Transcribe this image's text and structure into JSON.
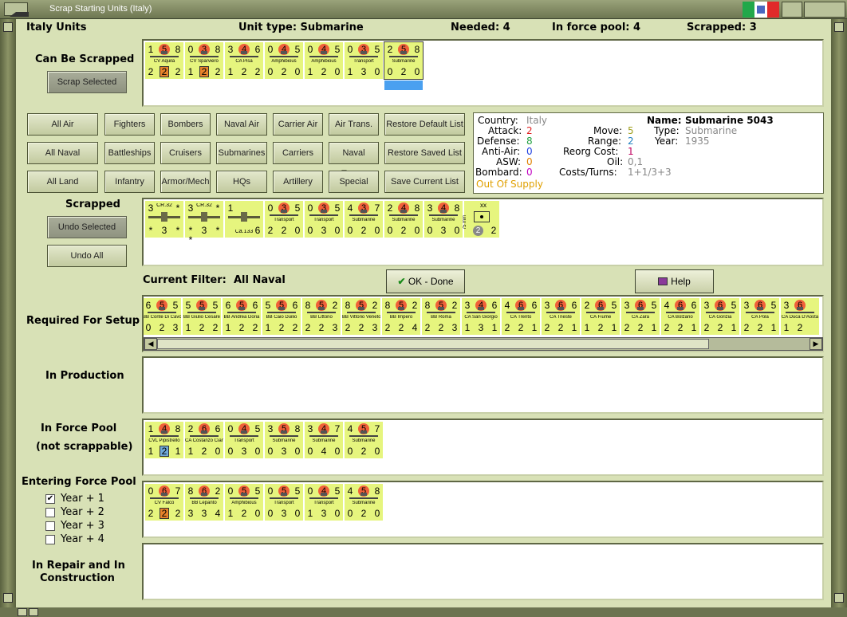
{
  "window": {
    "title": "Scrap Starting Units (Italy)",
    "flag_colors": [
      "#22a84a",
      "#ffffff",
      "#e02a2a"
    ]
  },
  "header": {
    "country_units": "Italy Units",
    "unit_type": "Unit type: Submarine",
    "needed": "Needed:  4",
    "in_force_pool": "In force pool:  4",
    "scrapped": "Scrapped:  3"
  },
  "can_be_scrapped": {
    "label": "Can Be Scrapped",
    "button": "Scrap Selected",
    "units": [
      {
        "a": "1",
        "c": "5",
        "d": "8",
        "name": "CV Aquila",
        "e": "2",
        "f": "2",
        "g": "2",
        "sq": "orange"
      },
      {
        "a": "0",
        "c": "3",
        "d": "8",
        "name": "CV Sparviero",
        "e": "1",
        "f": "2",
        "g": "2",
        "sq": "orange"
      },
      {
        "a": "3",
        "c": "4",
        "d": "6",
        "name": "CA Pisa",
        "e": "1",
        "f": "2",
        "g": "2"
      },
      {
        "a": "0",
        "c": "4",
        "d": "5",
        "name": "Amphibious",
        "e": "0",
        "f": "2",
        "g": "0"
      },
      {
        "a": "0",
        "c": "4",
        "d": "5",
        "name": "Amphibious",
        "e": "1",
        "f": "2",
        "g": "0"
      },
      {
        "a": "0",
        "c": "3",
        "d": "5",
        "name": "Transport",
        "e": "1",
        "f": "3",
        "g": "0"
      },
      {
        "a": "2",
        "c": "5",
        "d": "8",
        "name": "Submarine",
        "e": "0",
        "f": "2",
        "g": "0",
        "selected": true
      }
    ]
  },
  "filters": {
    "row1": [
      "All Air",
      "Fighters",
      "Bombers",
      "Naval Air",
      "Carrier Air",
      "Air Trans.",
      "Restore Default List"
    ],
    "row2": [
      "All Naval",
      "Battleships",
      "Cruisers",
      "Submarines",
      "Carriers",
      "Naval Trans.",
      "Restore Saved List"
    ],
    "row3": [
      "All Land",
      "Infantry",
      "Armor/Mech",
      "HQs",
      "Artillery",
      "Special",
      "Save Current List"
    ]
  },
  "info": {
    "country_label": "Country:",
    "country": "Italy",
    "attack_label": "Attack:",
    "attack": "2",
    "defense_label": "Defense:",
    "defense": "8",
    "antiair_label": "Anti-Air:",
    "antiair": "0",
    "asw_label": "ASW:",
    "asw": "0",
    "bombard_label": "Bombard:",
    "bombard": "0",
    "supply": "Out Of Supply",
    "name_label": "Name:",
    "name": "Submarine 5043",
    "type_label": "Type:",
    "type": "Submarine",
    "year_label": "Year:",
    "year": "1935",
    "move_label": "Move:",
    "move": "5",
    "range_label": "Range:",
    "range": "2",
    "reorg_label": "Reorg Cost:",
    "reorg": "1",
    "oil_label": "Oil:",
    "oil": "0,1",
    "costs_label": "Costs/Turns:",
    "costs": "1+1/3+3",
    "colors": {
      "attack": "#e02020",
      "defense": "#20a040",
      "antiair": "#2040e0",
      "asw": "#e08000",
      "bombard": "#c000c0",
      "supply": "#e0a000",
      "move": "#a0a020",
      "range": "#2080c0",
      "reorg": "#c00060",
      "grey": "#888888"
    }
  },
  "scrapped": {
    "label": "Scrapped",
    "undo_selected": "Undo Selected",
    "undo_all": "Undo All",
    "units": [
      {
        "kind": "air",
        "a": "3",
        "name": "CR.32",
        "e": "*",
        "f": "3",
        "g": "*",
        "top": "*"
      },
      {
        "kind": "air",
        "a": "3",
        "name": "CR.32",
        "e": "* *",
        "f": "3",
        "g": "*",
        "top": "*"
      },
      {
        "kind": "air",
        "a": "1",
        "name": "Ca.133",
        "e": "",
        "f": "",
        "g": "6"
      },
      {
        "a": "0",
        "c": "3",
        "d": "5",
        "name": "Transport",
        "e": "2",
        "f": "2",
        "g": "0"
      },
      {
        "a": "0",
        "c": "3",
        "d": "5",
        "name": "Transport",
        "e": "0",
        "f": "3",
        "g": "0"
      },
      {
        "a": "4",
        "c": "3",
        "d": "7",
        "name": "Submarine",
        "e": "0",
        "f": "2",
        "g": "0"
      },
      {
        "a": "2",
        "c": "4",
        "d": "8",
        "name": "Submarine",
        "e": "0",
        "f": "2",
        "g": "0"
      },
      {
        "a": "3",
        "c": "4",
        "d": "8",
        "name": "Submarine",
        "e": "0",
        "f": "3",
        "g": "0"
      },
      {
        "kind": "hq",
        "top": "xx",
        "side": "75 mm",
        "circ": "2",
        "g": "2"
      }
    ]
  },
  "filter_row": {
    "label": "Current Filter:",
    "value": "All Naval",
    "ok": "OK - Done",
    "help": "Help"
  },
  "required": {
    "label": "Required For Setup",
    "units": [
      {
        "a": "6",
        "c": "5",
        "d": "5",
        "name": "BB Conte Di Cavour",
        "e": "0",
        "f": "2",
        "g": "3"
      },
      {
        "a": "5",
        "c": "5",
        "d": "5",
        "name": "BB Giulio Cesare",
        "e": "1",
        "f": "2",
        "g": "2"
      },
      {
        "a": "6",
        "c": "5",
        "d": "6",
        "name": "BB Andrea Doria",
        "e": "1",
        "f": "2",
        "g": "2"
      },
      {
        "a": "5",
        "c": "5",
        "d": "6",
        "name": "BB Caio Duilio",
        "e": "1",
        "f": "2",
        "g": "2"
      },
      {
        "a": "8",
        "c": "5",
        "d": "2",
        "name": "BB Littorio",
        "e": "2",
        "f": "2",
        "g": "3"
      },
      {
        "a": "8",
        "c": "5",
        "d": "2",
        "name": "BB Vittorio Veneto",
        "e": "2",
        "f": "2",
        "g": "3"
      },
      {
        "a": "8",
        "c": "5",
        "d": "2",
        "name": "BB Impero",
        "e": "2",
        "f": "2",
        "g": "4"
      },
      {
        "a": "8",
        "c": "5",
        "d": "2",
        "name": "BB Roma",
        "e": "2",
        "f": "2",
        "g": "3"
      },
      {
        "a": "3",
        "c": "4",
        "d": "6",
        "name": "CA San Giorgio",
        "e": "1",
        "f": "3",
        "g": "1"
      },
      {
        "a": "4",
        "c": "6",
        "d": "6",
        "name": "CA Trento",
        "e": "2",
        "f": "2",
        "g": "1"
      },
      {
        "a": "3",
        "c": "6",
        "d": "6",
        "name": "CA Trieste",
        "e": "2",
        "f": "2",
        "g": "1"
      },
      {
        "a": "2",
        "c": "6",
        "d": "5",
        "name": "CA Fiume",
        "e": "1",
        "f": "2",
        "g": "1"
      },
      {
        "a": "3",
        "c": "6",
        "d": "5",
        "name": "CA Zara",
        "e": "2",
        "f": "2",
        "g": "1"
      },
      {
        "a": "4",
        "c": "6",
        "d": "6",
        "name": "CA Bolzano",
        "e": "2",
        "f": "2",
        "g": "1"
      },
      {
        "a": "3",
        "c": "6",
        "d": "5",
        "name": "CA Gorizia",
        "e": "2",
        "f": "2",
        "g": "1"
      },
      {
        "a": "3",
        "c": "6",
        "d": "5",
        "name": "CA Pola",
        "e": "2",
        "f": "2",
        "g": "1"
      },
      {
        "a": "3",
        "c": "6",
        "d": "",
        "name": "CA Duca D'Aosta",
        "e": "1",
        "f": "2",
        "g": ""
      }
    ]
  },
  "in_production": {
    "label": "In Production"
  },
  "in_force_pool": {
    "label1": "In Force Pool",
    "label2": "(not scrappable)",
    "units": [
      {
        "a": "1",
        "c": "4",
        "d": "8",
        "name": "CVL Pipistrello",
        "e": "1",
        "f": "2",
        "g": "1",
        "sq": "blue"
      },
      {
        "a": "2",
        "c": "6",
        "d": "6",
        "name": "CA Costanzo Ciano",
        "e": "1",
        "f": "2",
        "g": "0"
      },
      {
        "a": "0",
        "c": "4",
        "d": "5",
        "name": "Transport",
        "e": "0",
        "f": "3",
        "g": "0"
      },
      {
        "a": "3",
        "c": "5",
        "d": "8",
        "name": "Submarine",
        "e": "0",
        "f": "3",
        "g": "0"
      },
      {
        "a": "3",
        "c": "4",
        "d": "7",
        "name": "Submarine",
        "e": "0",
        "f": "4",
        "g": "0"
      },
      {
        "a": "4",
        "c": "5",
        "d": "7",
        "name": "Submarine",
        "e": "0",
        "f": "2",
        "g": "0"
      }
    ]
  },
  "entering": {
    "label": "Entering Force Pool",
    "years": [
      {
        "label": "Year + 1",
        "checked": true
      },
      {
        "label": "Year + 2",
        "checked": false
      },
      {
        "label": "Year + 3",
        "checked": false
      },
      {
        "label": "Year + 4",
        "checked": false
      }
    ],
    "units": [
      {
        "a": "0",
        "c": "6",
        "d": "7",
        "name": "CV Falco",
        "e": "2",
        "f": "2",
        "g": "2",
        "sq": "orange"
      },
      {
        "a": "8",
        "c": "6",
        "d": "2",
        "name": "BB Lepanto",
        "e": "3",
        "f": "3",
        "g": "4"
      },
      {
        "a": "0",
        "c": "5",
        "d": "5",
        "name": "Amphibious",
        "e": "1",
        "f": "2",
        "g": "0"
      },
      {
        "a": "0",
        "c": "5",
        "d": "5",
        "name": "Transport",
        "e": "0",
        "f": "3",
        "g": "0"
      },
      {
        "a": "0",
        "c": "4",
        "d": "5",
        "name": "Transport",
        "e": "1",
        "f": "3",
        "g": "0"
      },
      {
        "a": "4",
        "c": "5",
        "d": "8",
        "name": "Submarine",
        "e": "0",
        "f": "2",
        "g": "0"
      }
    ]
  },
  "repair": {
    "label1": "In Repair and In",
    "label2": "Construction"
  }
}
